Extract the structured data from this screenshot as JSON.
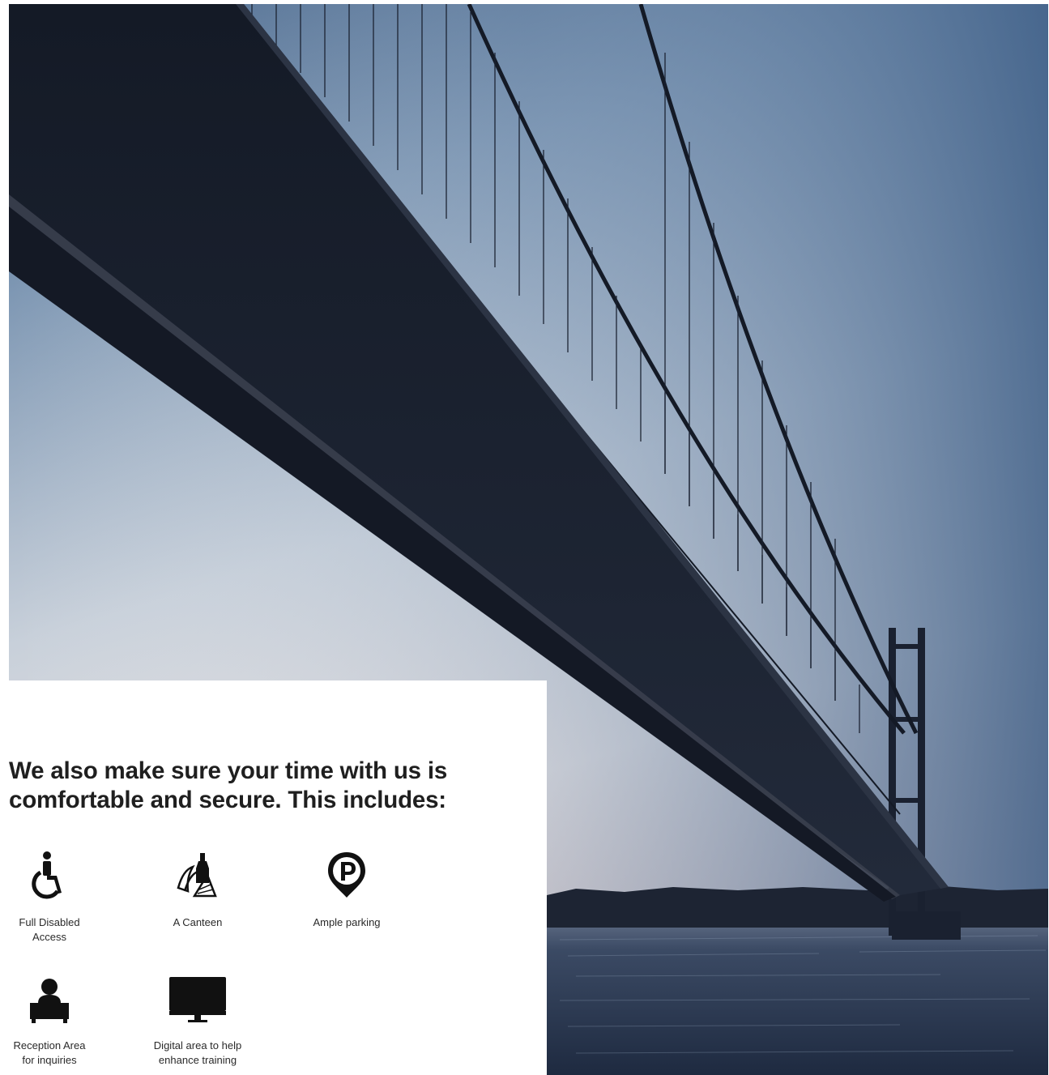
{
  "hero": {
    "image": "bridge-photo",
    "colors": {
      "sky_top": "#4a6a8e",
      "sky_mid": "#a7b8cc",
      "sky_low": "#e8e4e4",
      "bridge": "#1c2230",
      "water": "#2e3c55"
    }
  },
  "intro": {
    "headline": "We also make sure your time with us is comfortable and secure. This includes:"
  },
  "features": [
    {
      "icon": "wheelchair-icon",
      "label": "Full Disabled\nAccess"
    },
    {
      "icon": "canteen-icon",
      "label": "A Canteen"
    },
    {
      "icon": "parking-pin-icon",
      "label": "Ample parking"
    },
    {
      "icon": "reception-desk-icon",
      "label": "Reception Area\nfor inquiries"
    },
    {
      "icon": "monitor-icon",
      "label": "Digital area to help\nenhance training"
    }
  ]
}
